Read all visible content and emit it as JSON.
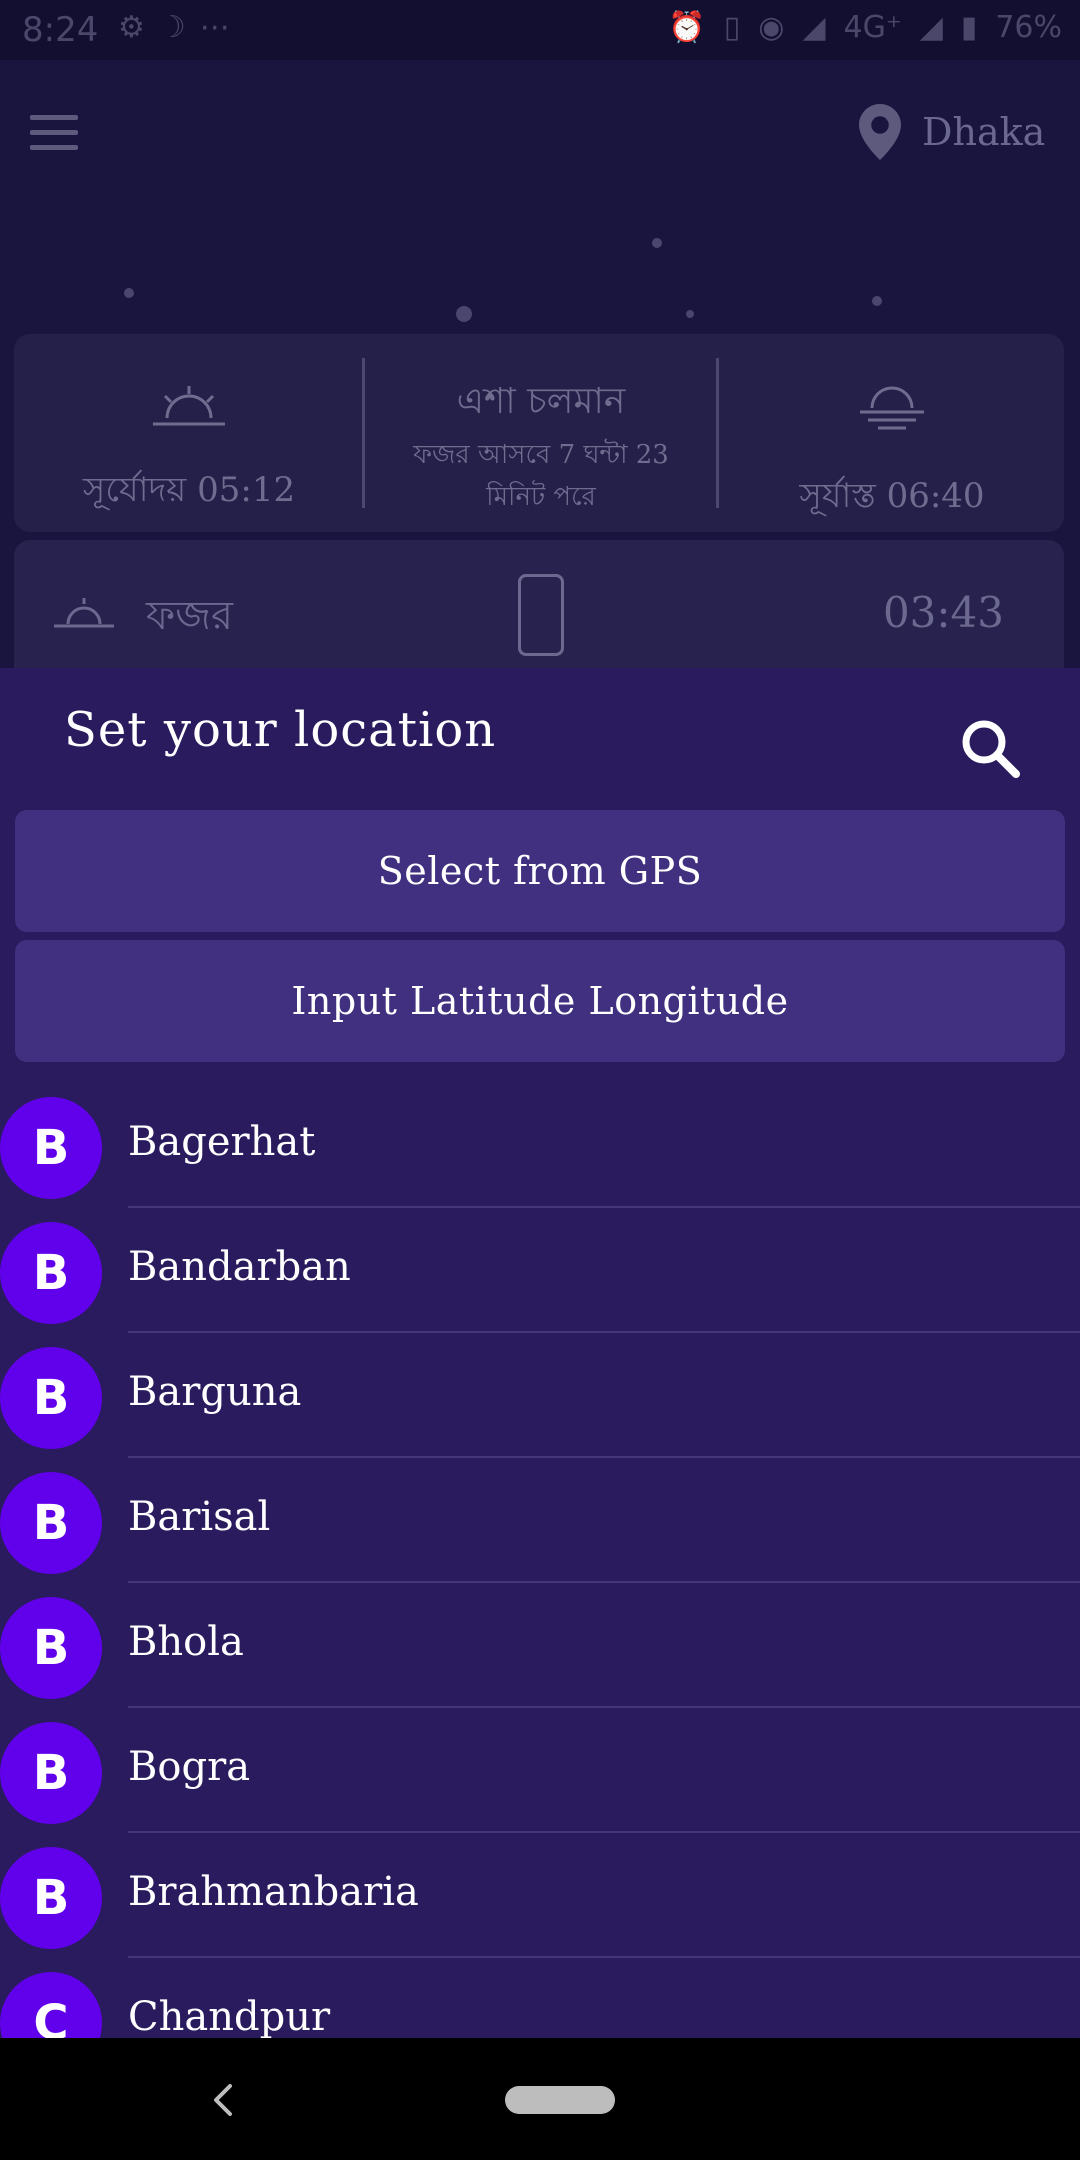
{
  "status_bar": {
    "time": "8:24",
    "network": "4G⁺",
    "battery": "76%"
  },
  "app_bar": {
    "location": "Dhaka"
  },
  "prayer_card": {
    "sunrise_label": "সূর্যোদয় 05:12",
    "current_prayer": "এশা চলমান",
    "countdown_line1": "ফজর আসবে 7 ঘন্টা 23",
    "countdown_line2": "মিনিট পরে",
    "sunset_label": "সূর্যাস্ত 06:40"
  },
  "next_prayer": {
    "name": "ফজর",
    "time": "03:43"
  },
  "sheet": {
    "title": "Set your location",
    "gps_button": "Select from GPS",
    "latlng_button": "Input Latitude Longitude",
    "cities": [
      {
        "initial": "B",
        "name": "Bagerhat"
      },
      {
        "initial": "B",
        "name": "Bandarban"
      },
      {
        "initial": "B",
        "name": "Barguna"
      },
      {
        "initial": "B",
        "name": "Barisal"
      },
      {
        "initial": "B",
        "name": "Bhola"
      },
      {
        "initial": "B",
        "name": "Bogra"
      },
      {
        "initial": "B",
        "name": "Brahmanbaria"
      },
      {
        "initial": "C",
        "name": "Chandpur"
      }
    ]
  },
  "colors": {
    "sheet_bg": "#2a1b5e",
    "button_bg": "#40307f",
    "avatar_bg": "#6100ea"
  }
}
